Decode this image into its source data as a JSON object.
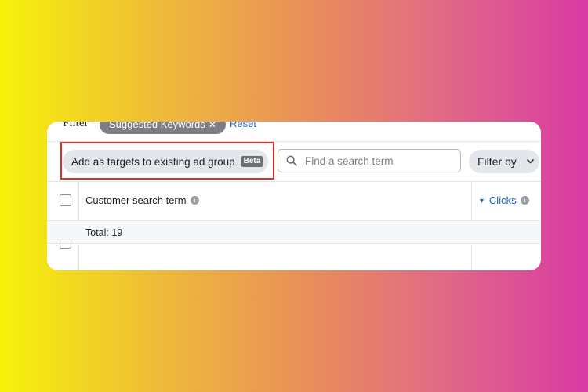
{
  "filter_bar": {
    "label": "Filter",
    "chip_label": "Suggested Keywords",
    "chip_close_icon": "close-icon",
    "reset_label": "Reset"
  },
  "toolbar": {
    "add_button_label": "Add as targets to existing ad group",
    "beta_badge": "Beta",
    "search_placeholder": "Find a search term",
    "search_value": "",
    "filter_by_label": "Filter by"
  },
  "table": {
    "columns": [
      {
        "label": "Customer search term",
        "icon": "info-icon"
      },
      {
        "label": "Clicks",
        "icon": "info-icon",
        "sort": "descending"
      }
    ],
    "total_label": "Total: 19"
  },
  "colors": {
    "highlight": "#d9322a",
    "link": "#1f66c7",
    "chip_bg": "#7d7f84",
    "button_bg": "#e3e6ea"
  }
}
